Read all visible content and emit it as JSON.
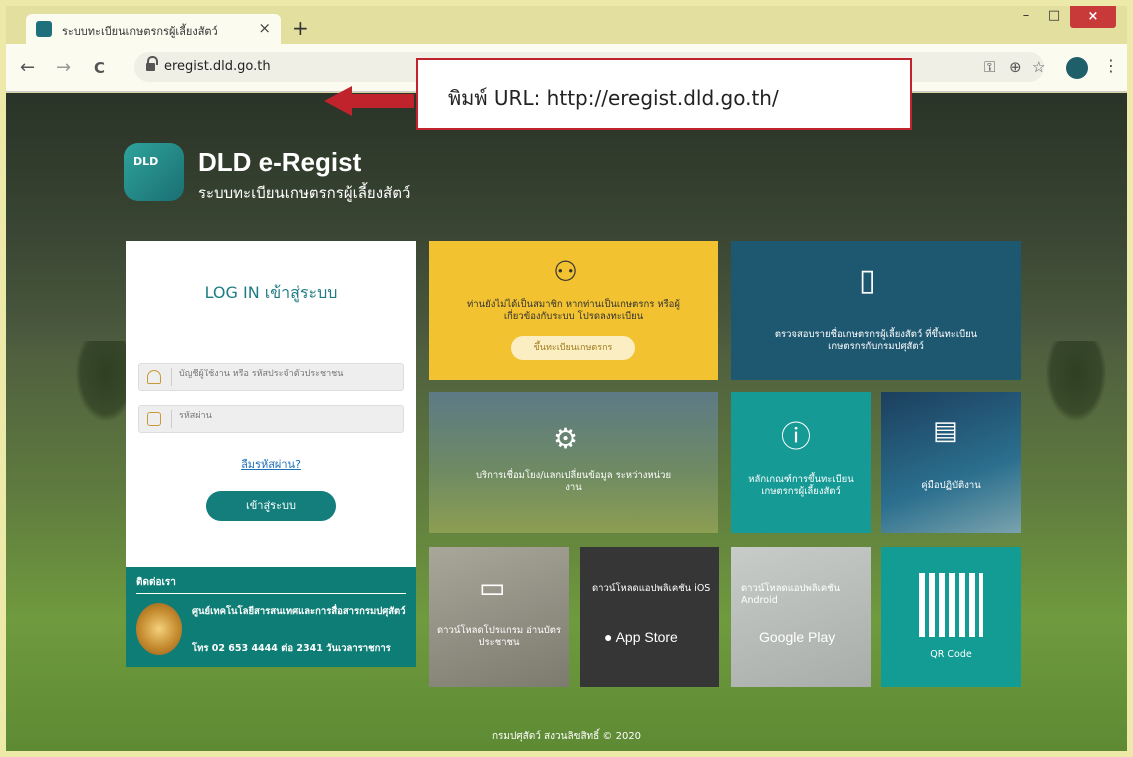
{
  "browser": {
    "tab_title": "ระบบทะเบียนเกษตรกรผู้เลี้ยงสัตว์",
    "tab_close": "×",
    "new_tab": "+",
    "url": "eregist.dld.go.th",
    "win_min": "–",
    "win_max": "□",
    "win_close": "×",
    "back": "←",
    "forward": "→",
    "reload": "C",
    "icons": [
      "key-icon",
      "zoom-icon",
      "star-icon",
      "profile-icon",
      "menu-icon"
    ]
  },
  "annotation": {
    "text": "พิมพ์ URL: http://eregist.dld.go.th/",
    "color": "#c0232b"
  },
  "brand": {
    "logo_text": "DLD",
    "title": "DLD e-Regist",
    "subtitle": "ระบบทะเบียนเกษตรกรผู้เลี้ยงสัตว์"
  },
  "login": {
    "title": "LOG IN เข้าสู่ระบบ",
    "username_placeholder": "บัญชีผู้ใช้งาน หรือ รหัสประจำตัวประชาชน",
    "password_placeholder": "รหัสผ่าน",
    "forgot": "ลืมรหัสผ่าน?",
    "submit": "เข้าสู่ระบบ"
  },
  "contact": {
    "heading": "ติดต่อเรา",
    "org": "ศูนย์เทคโนโลยีสารสนเทศและการสื่อสารกรมปศุสัตว์",
    "phone": "โทร 02 653 4444 ต่อ 2341 วันเวลาราชการ"
  },
  "tiles": {
    "register_text": "ท่านยังไม่ได้เป็นสมาชิก หากท่านเป็นเกษตรกร หรือผู้เกี่ยวข้องกับระบบ โปรดลงทะเบียน",
    "register_button": "ขึ้นทะเบียนเกษตรกร",
    "check_text": "ตรวจสอบรายชื่อเกษตรกรผู้เลี้ยงสัตว์ ที่ขึ้นทะเบียนเกษตรกรกับกรมปศุสัตว์",
    "service_text": "บริการเชื่อมโยง/แลกเปลี่ยนข้อมูล ระหว่างหน่วยงาน",
    "criteria_text": "หลักเกณฑ์การขึ้นทะเบียน เกษตรกรผู้เลี้ยงสัตว์",
    "manual_text": "คู่มือปฏิบัติงาน",
    "cardreader_text": "ดาวน์โหลดโปรแกรม อ่านบัตรประชาชน",
    "ios_text": "ดาวน์โหลดแอปพลิเคชัน iOS",
    "ios_store": " App Store",
    "android_text": "ดาวน์โหลดแอปพลิเคชัน Android",
    "android_store": "Google Play",
    "qr_text": "QR Code"
  },
  "footer": "กรมปศุสัตว์ สงวนลิขสิทธิ์ © 2020"
}
